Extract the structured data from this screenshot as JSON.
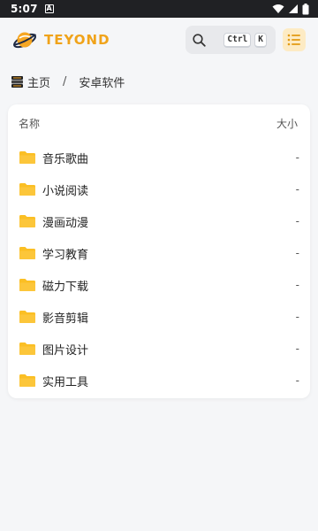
{
  "status": {
    "time": "5:07",
    "notif_letter": "A"
  },
  "brand": {
    "name": "TEYOND"
  },
  "search": {
    "kbd_ctrl": "Ctrl",
    "kbd_k": "K"
  },
  "breadcrumb": {
    "home": "主页",
    "separator": "/",
    "current": "安卓软件"
  },
  "table": {
    "header_name": "名称",
    "header_size": "大小",
    "rows": [
      {
        "name": "音乐歌曲",
        "size": "-"
      },
      {
        "name": "小说阅读",
        "size": "-"
      },
      {
        "name": "漫画动漫",
        "size": "-"
      },
      {
        "name": "学习教育",
        "size": "-"
      },
      {
        "name": "磁力下载",
        "size": "-"
      },
      {
        "name": "影音剪辑",
        "size": "-"
      },
      {
        "name": "图片设计",
        "size": "-"
      },
      {
        "name": "实用工具",
        "size": "-"
      }
    ]
  },
  "colors": {
    "accent": "#f0a31a",
    "folder": "#fbbf24",
    "menu_bg": "#fdebc4"
  }
}
